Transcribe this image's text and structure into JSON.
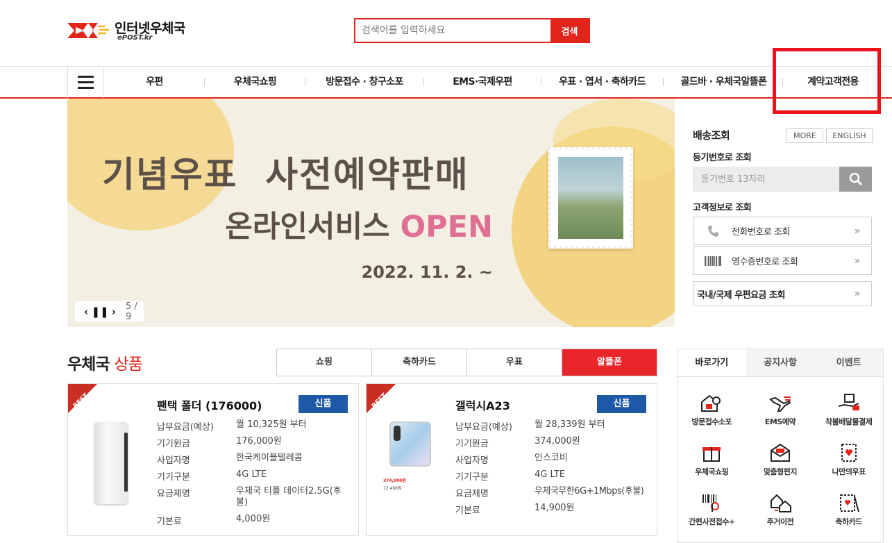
{
  "header": {
    "logo_text": "인터넷우체국",
    "logo_sub": "ePOST.kr",
    "search_placeholder": "검색어를 입력하세요",
    "search_button": "검색",
    "colors": {
      "brand": "#e1251b",
      "highlight": "#e8141c"
    }
  },
  "nav": {
    "items": [
      "우편",
      "우체국쇼핑",
      "방문접수 · 창구소포",
      "EMS·국제우편",
      "우표 · 엽서 · 축하카드",
      "골드바 · 우체국알뜰폰",
      "계약고객전용"
    ]
  },
  "banner": {
    "title": "기념우표  사전예약판매",
    "sub_prefix": "온라인서비스 ",
    "sub_accent": "OPEN",
    "date": "2022. 11. 2. ~",
    "counter": "5 / 9"
  },
  "delivery": {
    "title": "배송조회",
    "more": "MORE",
    "english": "ENGLISH",
    "reg_label": "등기번호로 조회",
    "reg_placeholder": "등기번호 13자리",
    "customer_label": "고객정보로 조회",
    "phone_lookup": "전화번호로 조회",
    "receipt_lookup": "영수증번호로 조회",
    "rate_lookup": "국내/국제 우편요금 조회",
    "arrow": "»"
  },
  "products": {
    "title_prefix": "우체국 ",
    "title_accent": "상품",
    "tabs": [
      "쇼핑",
      "축하카드",
      "우표",
      "알뜰폰"
    ],
    "active_tab": "알뜰폰",
    "best": "BEST",
    "cards": [
      {
        "name": "팬택 폴더 (176000)",
        "badge": "신품",
        "rows": [
          {
            "k": "납부요금(예상)",
            "v": "월 10,325원 부터"
          },
          {
            "k": "기기원금",
            "v": "176,000원"
          },
          {
            "k": "사업자명",
            "v": "한국케이블텔레콤"
          },
          {
            "k": "기기구분",
            "v": "4G LTE"
          },
          {
            "k": "요금제명",
            "v": "우체국 티플 데이터2.5G(후불)"
          },
          {
            "k": "기본료",
            "v": "4,000원"
          }
        ]
      },
      {
        "name": "갤럭시A23",
        "badge": "신품",
        "price_line1": "374,000원",
        "price_line2": "12,466원",
        "rows": [
          {
            "k": "납부요금(예상)",
            "v": "월 28,339원 부터"
          },
          {
            "k": "기기원금",
            "v": "374,000원"
          },
          {
            "k": "사업자명",
            "v": "인스코비"
          },
          {
            "k": "기기구분",
            "v": "4G LTE"
          },
          {
            "k": "요금제명",
            "v": "우체국무한6G+1Mbps(후불)"
          },
          {
            "k": "기본료",
            "v": "14,900원"
          }
        ]
      }
    ]
  },
  "quick": {
    "tabs": [
      "바로가기",
      "공지사항",
      "이벤트"
    ],
    "items": [
      {
        "label": "방문접수소포",
        "icon": "house-courier-icon"
      },
      {
        "label": "EMS예약",
        "icon": "plane-icon"
      },
      {
        "label": "착불배달물결제",
        "icon": "hand-package-icon"
      },
      {
        "label": "우체국쇼핑",
        "icon": "gift-icon"
      },
      {
        "label": "맞춤형편지",
        "icon": "letter-icon"
      },
      {
        "label": "나만의우표",
        "icon": "stamp-heart-icon"
      },
      {
        "label": "간편사전접수+",
        "icon": "barcode-hand-icon"
      },
      {
        "label": "주거이전",
        "icon": "house-move-icon"
      },
      {
        "label": "축하카드",
        "icon": "card-icon"
      }
    ]
  }
}
